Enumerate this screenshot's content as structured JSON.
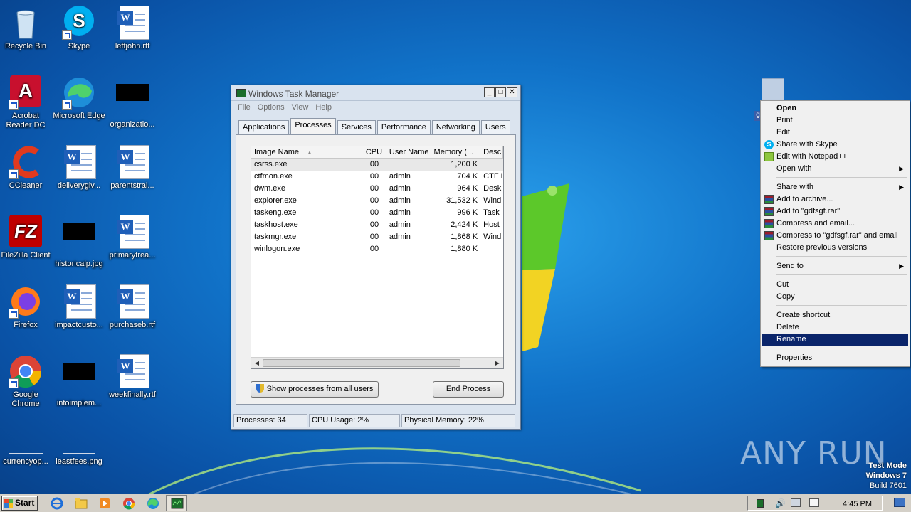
{
  "desktop": {
    "icons": [
      {
        "label": "Recycle Bin"
      },
      {
        "label": "Skype"
      },
      {
        "label": "leftjohn.rtf"
      },
      {
        "label": "Acrobat Reader DC"
      },
      {
        "label": "Microsoft Edge"
      },
      {
        "label": "organizatio..."
      },
      {
        "label": "CCleaner"
      },
      {
        "label": "deliverygiv..."
      },
      {
        "label": "parentstrai..."
      },
      {
        "label": "FileZilla Client"
      },
      {
        "label": "historicalp.jpg"
      },
      {
        "label": "primarytrea..."
      },
      {
        "label": "Firefox"
      },
      {
        "label": "impactcusto..."
      },
      {
        "label": "purchaseb.rtf"
      },
      {
        "label": "Google Chrome"
      },
      {
        "label": "intoimplem..."
      },
      {
        "label": "weekfinally.rtf"
      },
      {
        "label": "currencyop..."
      },
      {
        "label": "leastfees.png"
      }
    ],
    "selected_file_label": "g"
  },
  "task_manager": {
    "title": "Windows Task Manager",
    "menu": [
      "File",
      "Options",
      "View",
      "Help"
    ],
    "tabs": [
      "Applications",
      "Processes",
      "Services",
      "Performance",
      "Networking",
      "Users"
    ],
    "active_tab": "Processes",
    "columns": [
      "Image Name",
      "CPU",
      "User Name",
      "Memory (...",
      "Desc"
    ],
    "rows": [
      {
        "name": "csrss.exe",
        "cpu": "00",
        "user": "",
        "mem": "1,200 K",
        "desc": ""
      },
      {
        "name": "ctfmon.exe",
        "cpu": "00",
        "user": "admin",
        "mem": "704 K",
        "desc": "CTF L"
      },
      {
        "name": "dwm.exe",
        "cpu": "00",
        "user": "admin",
        "mem": "964 K",
        "desc": "Desk"
      },
      {
        "name": "explorer.exe",
        "cpu": "00",
        "user": "admin",
        "mem": "31,532 K",
        "desc": "Wind"
      },
      {
        "name": "taskeng.exe",
        "cpu": "00",
        "user": "admin",
        "mem": "996 K",
        "desc": "Task"
      },
      {
        "name": "taskhost.exe",
        "cpu": "00",
        "user": "admin",
        "mem": "2,424 K",
        "desc": "Host"
      },
      {
        "name": "taskmgr.exe",
        "cpu": "00",
        "user": "admin",
        "mem": "1,868 K",
        "desc": "Wind"
      },
      {
        "name": "winlogon.exe",
        "cpu": "00",
        "user": "",
        "mem": "1,880 K",
        "desc": ""
      }
    ],
    "show_all_button": "Show processes from all users",
    "end_process_button": "End Process",
    "status": {
      "processes": "Processes: 34",
      "cpu": "CPU Usage: 2%",
      "memory": "Physical Memory: 22%"
    }
  },
  "context_menu": {
    "items": [
      {
        "label": "Open"
      },
      {
        "label": "Print"
      },
      {
        "label": "Edit"
      },
      {
        "label": "Share with Skype",
        "icon": "skype-icon"
      },
      {
        "label": "Edit with Notepad++",
        "icon": "notepadpp-icon"
      },
      {
        "label": "Open with"
      },
      {
        "label": "Share with"
      },
      {
        "label": "Add to archive...",
        "icon": "winrar-icon"
      },
      {
        "label": "Add to \"gdfsgf.rar\"",
        "icon": "winrar-icon"
      },
      {
        "label": "Compress and email...",
        "icon": "winrar-icon"
      },
      {
        "label": "Compress to \"gdfsgf.rar\" and email",
        "icon": "winrar-icon"
      },
      {
        "label": "Restore previous versions"
      },
      {
        "label": "Send to"
      },
      {
        "label": "Cut"
      },
      {
        "label": "Copy"
      },
      {
        "label": "Create shortcut"
      },
      {
        "label": "Delete"
      },
      {
        "label": "Rename"
      },
      {
        "label": "Properties"
      }
    ],
    "highlighted": "Rename"
  },
  "watermark": {
    "anyrun": "ANY RUN",
    "line1": "Test Mode",
    "line2": "Windows 7",
    "line3": "Build 7601"
  },
  "taskbar": {
    "start_label": "Start",
    "clock": "4:45 PM"
  },
  "colors": {
    "menu_highlight": "#0a246a",
    "desktop_blue": "#1173c9"
  }
}
